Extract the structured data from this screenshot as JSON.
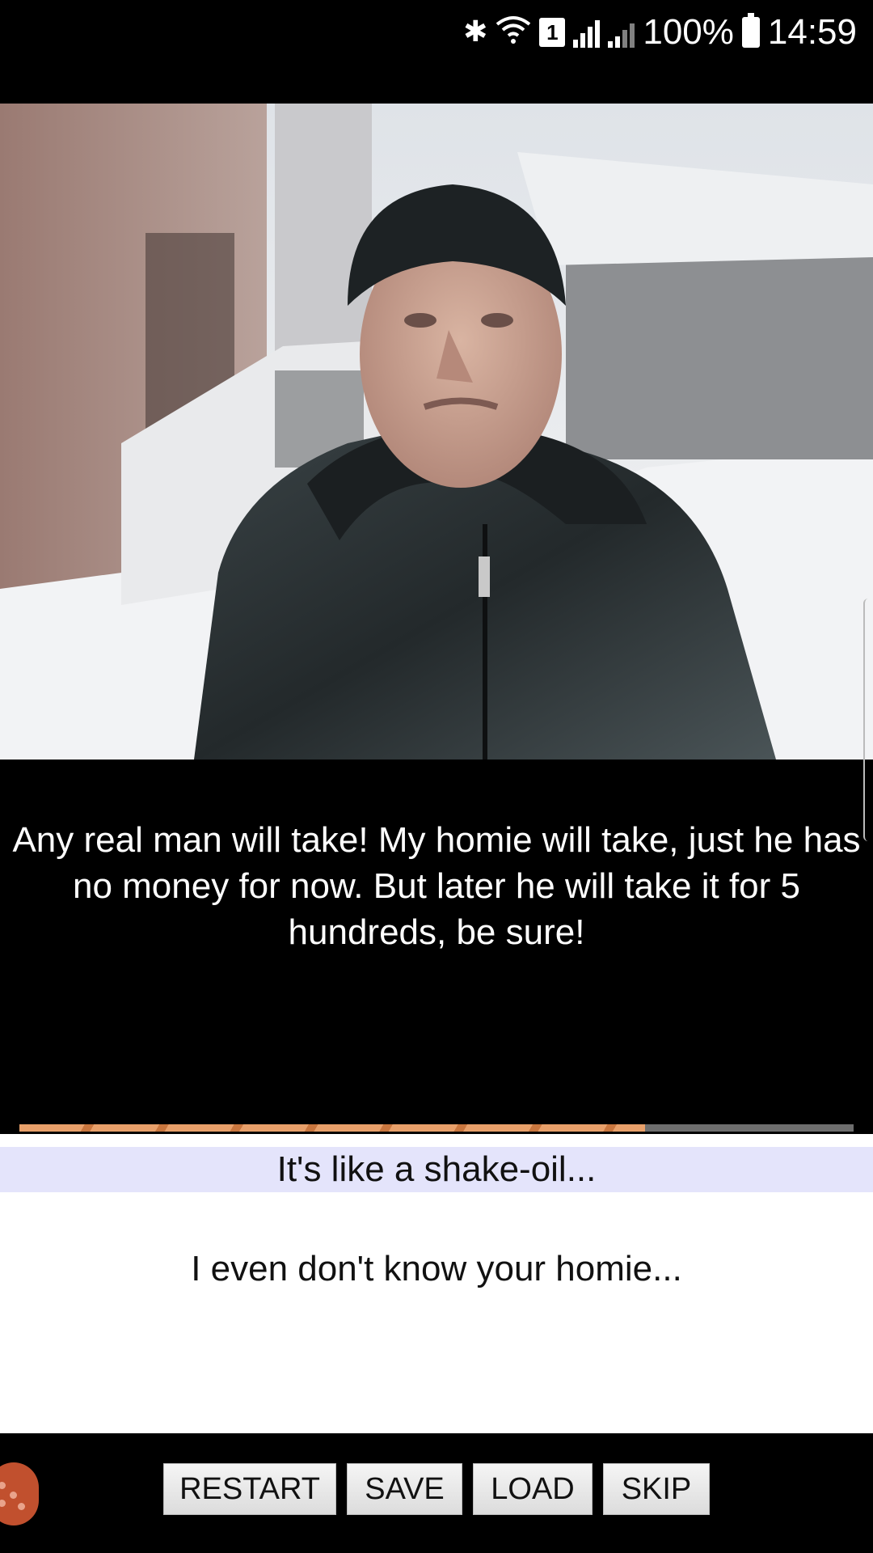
{
  "status_bar": {
    "bluetooth_icon": "bluetooth-icon",
    "wifi_icon": "wifi-icon",
    "sim_label": "1",
    "battery": "100%",
    "time": "14:59"
  },
  "scene": {
    "image_alt": "man-in-black-jacket-snow-scene"
  },
  "dialogue": {
    "text": "Any real man will take! My homie will take, just he has no money for now. But later he will take it for 5 hundreds, be sure!"
  },
  "progress": {
    "fraction": 0.75
  },
  "choices": [
    {
      "label": "It's like a shake-oil..."
    },
    {
      "label": "I even don't know your homie..."
    }
  ],
  "toolbar": {
    "restart_label": "RESTART",
    "save_label": "SAVE",
    "load_label": "LOAD",
    "skip_label": "SKIP"
  },
  "colors": {
    "choice_highlight": "#e4e4fb",
    "progress_fill": "#e8a06a",
    "fab": "#c1502e"
  }
}
